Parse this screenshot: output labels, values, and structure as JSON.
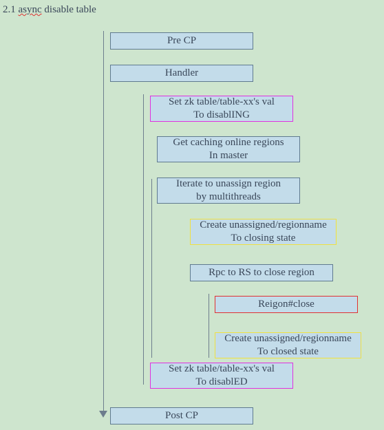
{
  "title": {
    "prefix": "2.1 ",
    "word": "async",
    "suffix": " disable table"
  },
  "boxes": {
    "pre_cp": "Pre CP",
    "handler": "Handler",
    "set_disabling_l1": "Set zk table/table-xx's val",
    "set_disabling_l2": "To disablING",
    "get_caching_l1": "Get caching online regions",
    "get_caching_l2": "In master",
    "iterate_l1": "Iterate to unassign region",
    "iterate_l2": "by multithreads",
    "create_closing_l1": "Create unassigned/regionname",
    "create_closing_l2": "To closing state",
    "rpc": "Rpc to RS to close region",
    "region_close": "Reigon#close",
    "create_closed_l1": "Create unassigned/regionname",
    "create_closed_l2": "To closed state",
    "set_disabled_l1": "Set zk table/table-xx's val",
    "set_disabled_l2": "To disablED",
    "post_cp": "Post CP"
  }
}
